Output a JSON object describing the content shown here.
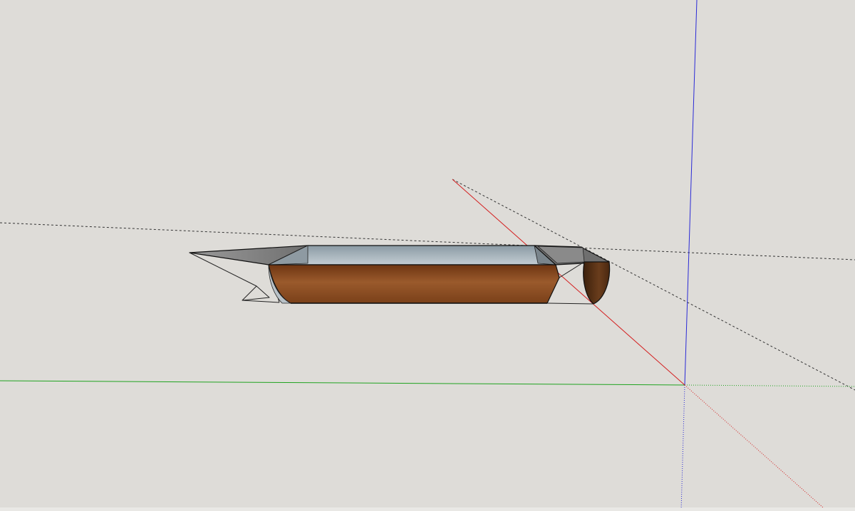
{
  "viewport": {
    "background": "#dedcd8"
  },
  "axes": {
    "red_color": "#d42020",
    "green_color": "#1fa31f",
    "blue_color": "#2a2ad6",
    "origin_visible": true
  },
  "model": {
    "shape": "boat-hull",
    "hull_color": "#8a4a22",
    "deck_color": "#a7b3bb",
    "panel_color": "#7a7a7a",
    "stern_color": "#5c3418",
    "outline_color": "#111111"
  },
  "guides": {
    "style": "dashed",
    "color": "#333333"
  }
}
